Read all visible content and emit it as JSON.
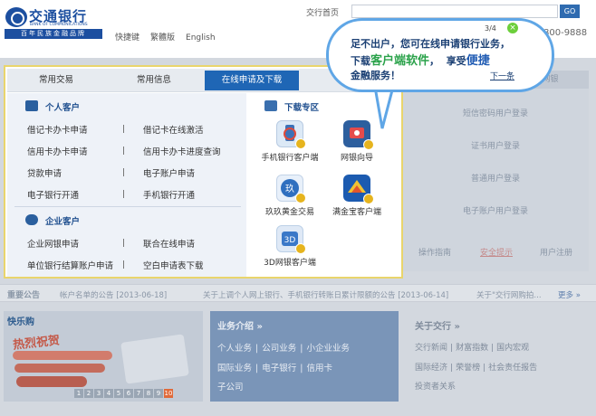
{
  "header": {
    "logo_cn": "交通银行",
    "logo_en": "BANK OF COMMUNICATIONS",
    "logo_band": "百年民族金融品牌",
    "subnav": [
      "快捷键",
      "繁體版",
      "English"
    ],
    "top_link": "交行首页",
    "search_btn": "GO",
    "phone": "800-9888"
  },
  "bubble": {
    "counter": "3/4",
    "close": "×",
    "line1": "足不出户，您可在线申请银行业务，",
    "line2_a": "下载",
    "line2_hi": "客户端软件",
    "line2_b": "，",
    "line2_c": "享受",
    "line2_hi2": "便捷",
    "line3": "金融服务！",
    "next": "下一条"
  },
  "menu": {
    "tabs": [
      "常用交易",
      "常用信息",
      "在线申请及下载"
    ],
    "personal": {
      "title": "个人客户",
      "items": [
        [
          "借记卡办卡申请",
          "借记卡在线激活"
        ],
        [
          "信用卡办卡申请",
          "信用卡办卡进度查询"
        ],
        [
          "贷款申请",
          "电子账户申请"
        ],
        [
          "电子银行开通",
          "手机银行开通"
        ]
      ]
    },
    "business": {
      "title": "企业客户",
      "items": [
        [
          "企业网银申请",
          "联合在线申请"
        ],
        [
          "单位银行结算账户申请",
          "空白申请表下载"
        ]
      ]
    },
    "download": {
      "title": "下载专区",
      "apps": [
        {
          "label": "手机银行客户端",
          "icon": "mobile-bank-icon"
        },
        {
          "label": "网银向导",
          "icon": "ebank-guide-icon"
        },
        {
          "label": "玖玖黄金交易",
          "icon": "gold-trade-icon"
        },
        {
          "label": "满金宝客户端",
          "icon": "manjinbao-icon"
        },
        {
          "label": "3D网银客户端",
          "icon": "3d-ebank-icon"
        }
      ]
    }
  },
  "right_panel": {
    "tabs": [
      "",
      "企业网银"
    ],
    "rows": [
      "短信密码用户登录",
      "证书用户登录",
      "普通用户登录",
      "电子账户用户登录"
    ],
    "links": [
      "操作指南",
      "安全提示",
      "用户注册"
    ]
  },
  "announce": {
    "label": "重要公告",
    "items": [
      "帐户名单的公告 [2013-06-18]",
      "关于上调个人网上银行、手机银行转账日累计限额的公告 [2013-06-14]",
      "关于\"交行网购拍..."
    ],
    "more": "更多 »"
  },
  "promo": {
    "title": "快乐购",
    "headline": "热烈祝贺",
    "pages": [
      "1",
      "2",
      "3",
      "4",
      "5",
      "6",
      "7",
      "8",
      "9",
      "10"
    ],
    "active_page": "10"
  },
  "business_intro": {
    "title": "业务介绍 »",
    "rows": [
      [
        "个人业务",
        "|",
        "公司业务",
        "|",
        "小企业业务"
      ],
      [
        "国际业务",
        "|",
        "电子银行",
        "|",
        "信用卡"
      ],
      [
        "子公司"
      ]
    ]
  },
  "about": {
    "title": "关于交行 »",
    "rows": [
      [
        "交行新闻",
        "|",
        "财富指数",
        "|",
        "国内宏观"
      ],
      [
        "国际经济",
        "|",
        "荣誉榜",
        "|",
        "社会责任报告"
      ],
      [
        "投资者关系"
      ]
    ]
  },
  "colors": {
    "brand_blue": "#1f66b5",
    "bubble_border": "#5fa6e6",
    "panel_border": "#e9d56c",
    "highlight_green": "#2aa24a"
  }
}
